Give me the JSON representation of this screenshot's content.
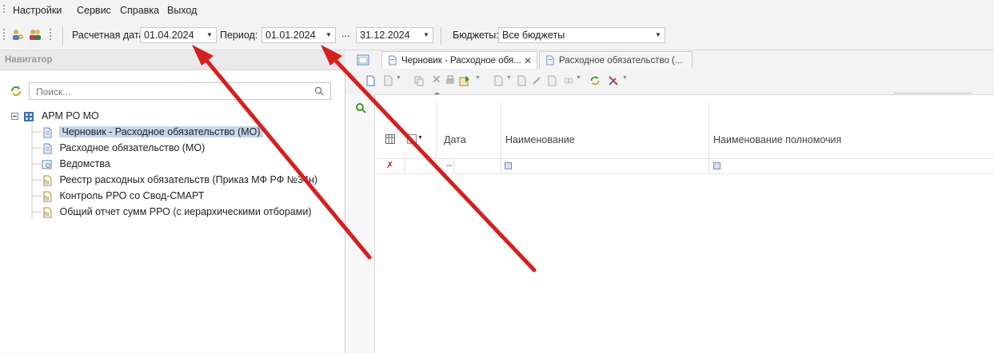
{
  "menu": {
    "items": [
      "Настройки",
      "Сервис",
      "Справка",
      "Выход"
    ]
  },
  "toolbar": {
    "calc_date_label": "Расчетная дата:",
    "calc_date_value": "01.04.2024",
    "period_label": "Период:",
    "period_from": "01.01.2024",
    "period_ellipsis": "...",
    "period_to": "31.12.2024",
    "budgets_label": "Бюджеты:",
    "budgets_value": "Все бюджеты"
  },
  "navigator": {
    "title": "Навигатор",
    "search_placeholder": "Поиск...",
    "root": "АРМ РО МО",
    "items": [
      "Черновик - Расходное обязательство (МО)",
      "Расходное обязательство (МО)",
      "Ведомства",
      "Реестр расходных обязательств (Приказ МФ РФ №34н)",
      "Контроль РРО со Свод-СМАРТ",
      "Общий отчет сумм РРО (с иерархическими отборами)"
    ]
  },
  "tabs": [
    {
      "label": "Черновик - Расходное обя..."
    },
    {
      "label": "Расходное обязательство (..."
    }
  ],
  "grid": {
    "columns": [
      "Дата",
      "Наименование",
      "Наименование полномочия"
    ]
  },
  "colors": {
    "accent": "#c5d6ee",
    "arrow": "#d61f1f",
    "refresh_green": "#3a9d2a"
  }
}
